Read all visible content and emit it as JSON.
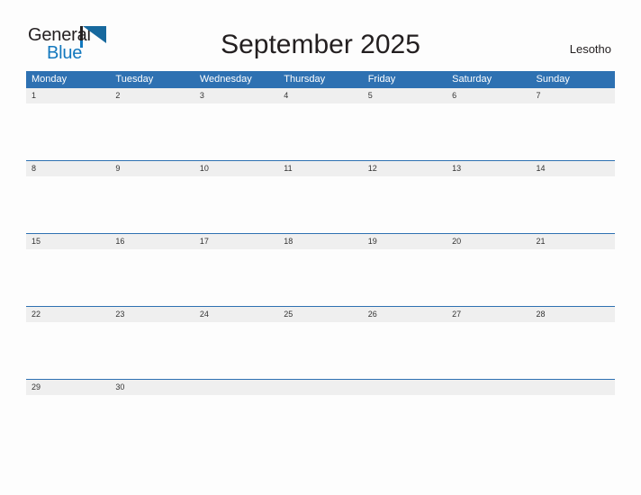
{
  "brand": {
    "word_one": "General",
    "word_two": "Blue",
    "flag_icon": "flag-triangle-icon",
    "color_dark": "#231f20",
    "color_blue": "#1278be"
  },
  "header": {
    "title": "September 2025",
    "region": "Lesotho"
  },
  "colors": {
    "header_blue": "#2e71b2",
    "row_divider_blue": "#2e71b2",
    "daynum_band": "#efefef",
    "page_background": "#fdfdfd",
    "text": "#231f20"
  },
  "calendar": {
    "weekdays": [
      "Monday",
      "Tuesday",
      "Wednesday",
      "Thursday",
      "Friday",
      "Saturday",
      "Sunday"
    ],
    "weeks": [
      [
        "1",
        "2",
        "3",
        "4",
        "5",
        "6",
        "7"
      ],
      [
        "8",
        "9",
        "10",
        "11",
        "12",
        "13",
        "14"
      ],
      [
        "15",
        "16",
        "17",
        "18",
        "19",
        "20",
        "21"
      ],
      [
        "22",
        "23",
        "24",
        "25",
        "26",
        "27",
        "28"
      ],
      [
        "29",
        "30",
        "",
        "",
        "",
        "",
        ""
      ]
    ]
  }
}
